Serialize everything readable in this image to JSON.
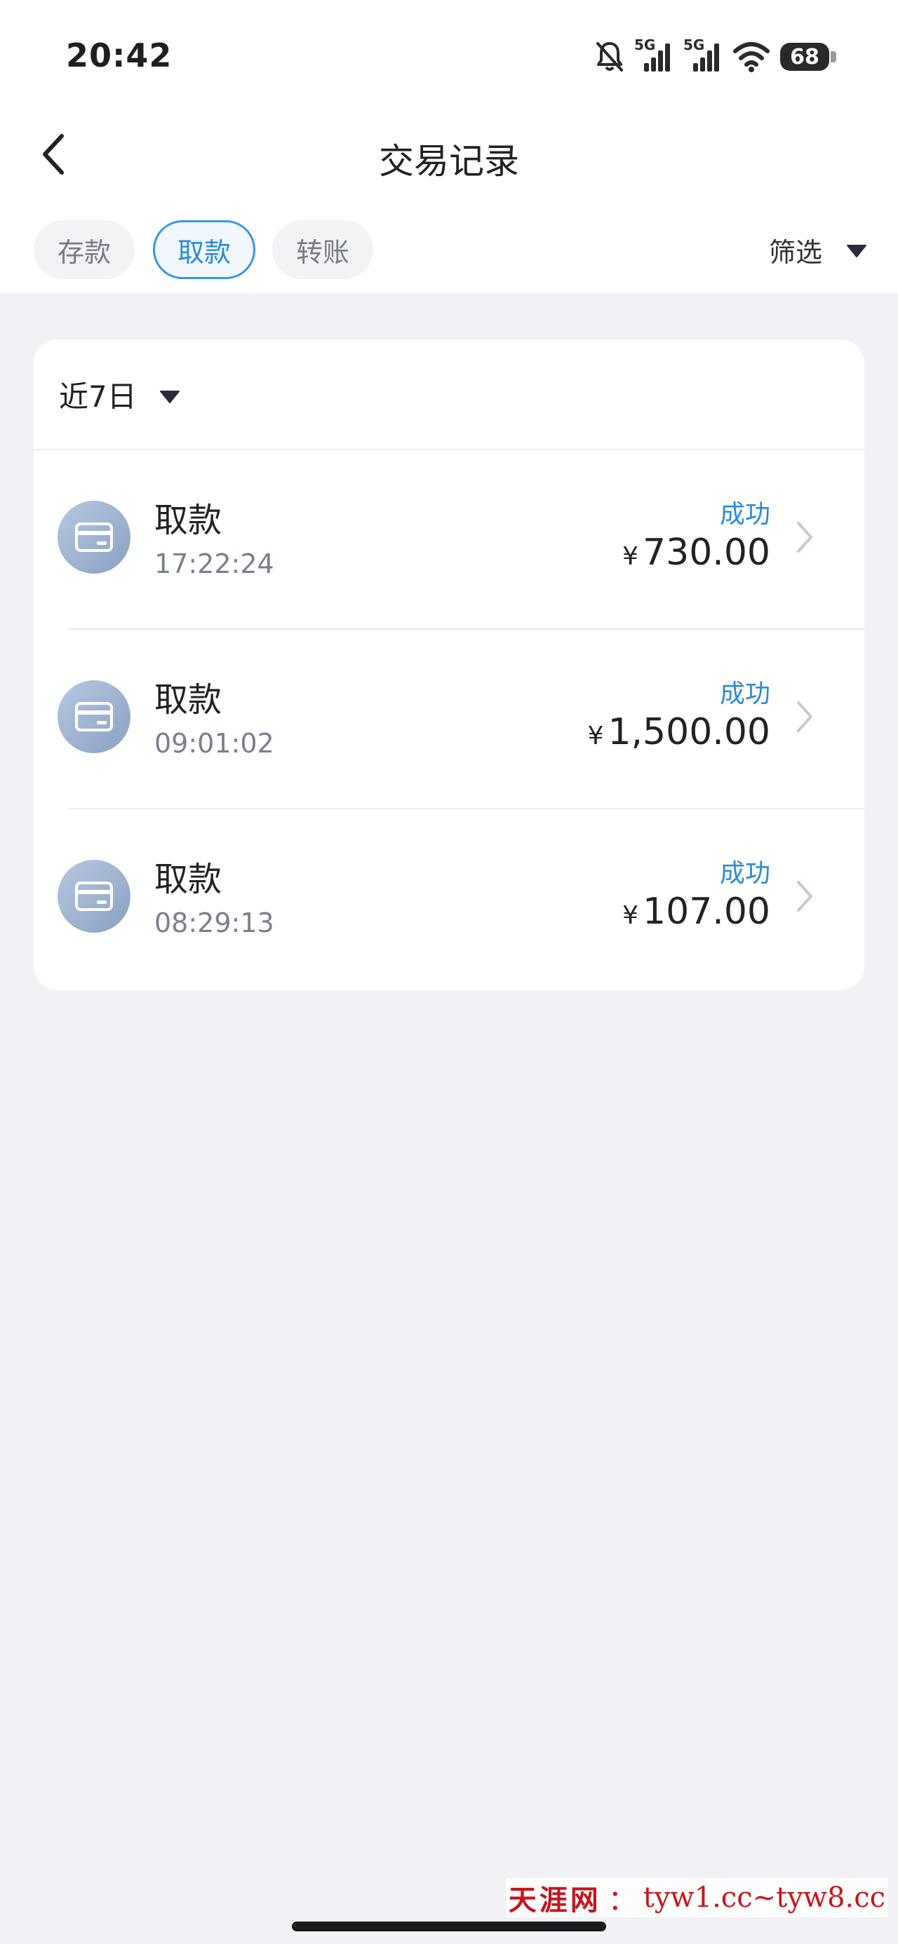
{
  "status_bar": {
    "time": "20:42",
    "network_1": "5G",
    "network_2": "5G",
    "battery": "68"
  },
  "header": {
    "title": "交易记录"
  },
  "tabs": [
    {
      "label": "存款",
      "active": false
    },
    {
      "label": "取款",
      "active": true
    },
    {
      "label": "转账",
      "active": false
    }
  ],
  "filter": {
    "label": "筛选"
  },
  "range": {
    "label": "近7日"
  },
  "transactions": [
    {
      "type": "取款",
      "time": "17:22:24",
      "status": "成功",
      "currency": "¥",
      "amount": "730.00"
    },
    {
      "type": "取款",
      "time": "09:01:02",
      "status": "成功",
      "currency": "¥",
      "amount": "1,500.00"
    },
    {
      "type": "取款",
      "time": "08:29:13",
      "status": "成功",
      "currency": "¥",
      "amount": "107.00"
    }
  ],
  "watermark": {
    "brand": "天涯网",
    "separator": "：",
    "url": "tyw1.cc~tyw8.cc"
  },
  "colors": {
    "accent": "#2b8ad8",
    "background": "#f1f1f6",
    "card": "#ffffff",
    "icon_gradient_start": "#b7c8e1",
    "icon_gradient_end": "#8aa1c2"
  },
  "icons": {
    "back": "chevron-left-icon",
    "filter": "caret-down-icon",
    "range": "caret-down-icon",
    "transaction": "bank-card-icon",
    "row": "chevron-right-icon"
  }
}
